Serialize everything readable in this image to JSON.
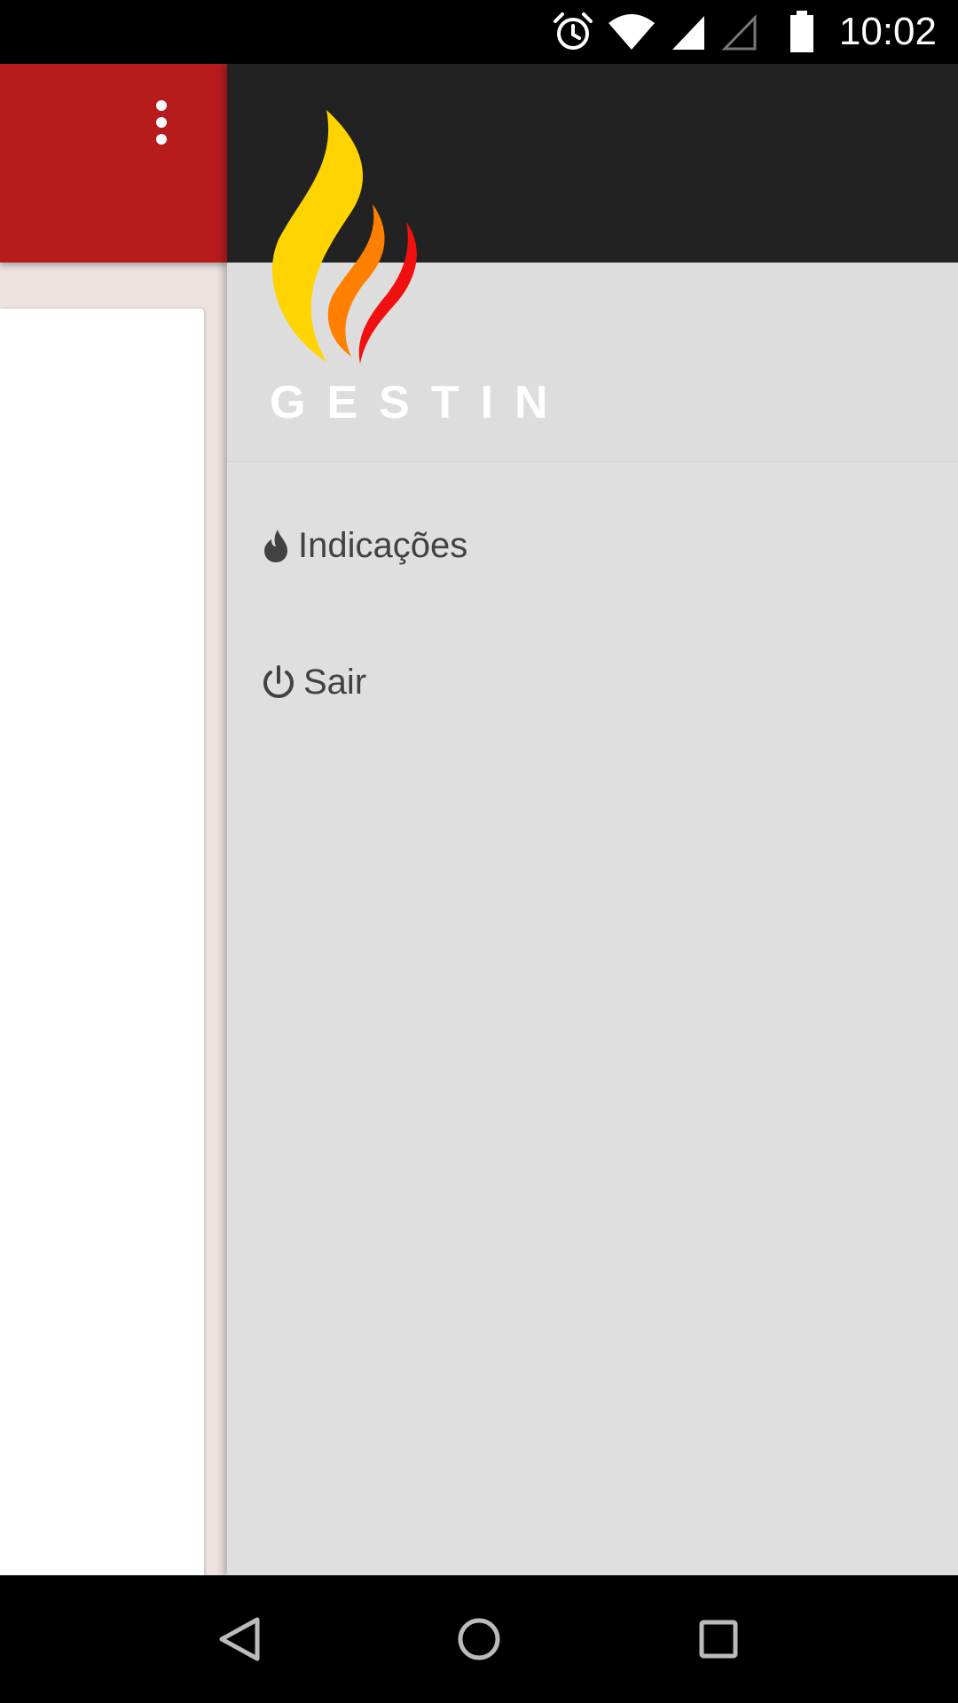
{
  "status_bar": {
    "time": "10:02",
    "icons": [
      "alarm-icon",
      "wifi-icon",
      "cell-signal-icon",
      "cell-signal-empty-icon",
      "battery-icon"
    ]
  },
  "toolbar": {
    "color": "#b71c1c",
    "overflow_icon": "more-vert-icon"
  },
  "drawer": {
    "header_color": "#222222",
    "logo_text": "GESTIN",
    "logo_colors": [
      "#ffd400",
      "#ff8000",
      "#f01010"
    ],
    "menu": [
      {
        "icon": "flame-icon",
        "label": "Indicações"
      },
      {
        "icon": "power-icon",
        "label": "Sair"
      }
    ]
  },
  "nav_bar": {
    "buttons": [
      "back-icon",
      "home-icon",
      "recents-icon"
    ]
  }
}
